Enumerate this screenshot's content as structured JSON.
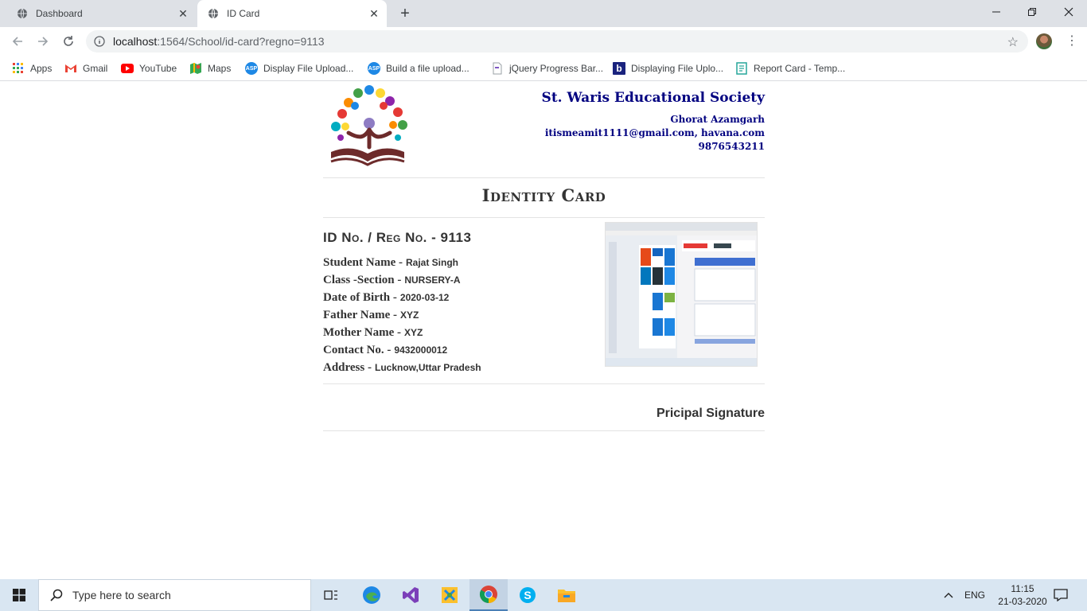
{
  "browser": {
    "tabs": [
      {
        "label": "Dashboard",
        "active": false
      },
      {
        "label": "ID Card",
        "active": true
      }
    ],
    "url_host": "localhost",
    "url_path": ":1564/School/id-card?regno=9113",
    "bookmarks": [
      {
        "label": "Apps",
        "icon": "apps-grid-icon"
      },
      {
        "label": "Gmail",
        "icon": "gmail-icon"
      },
      {
        "label": "YouTube",
        "icon": "youtube-icon"
      },
      {
        "label": "Maps",
        "icon": "maps-icon"
      },
      {
        "label": "Display File Upload...",
        "icon": "asp-icon"
      },
      {
        "label": "Build a file upload...",
        "icon": "asp-icon"
      },
      {
        "label": "jQuery Progress Bar...",
        "icon": "page-icon"
      },
      {
        "label": "Displaying File Uplo...",
        "icon": "b-icon"
      },
      {
        "label": "Report Card - Temp...",
        "icon": "template-icon"
      }
    ]
  },
  "card": {
    "org_name": "St. Waris Educational Society",
    "address_line": "Ghorat Azamgarh",
    "contact_line": "itismeamit1111@gmail.com,  havana.com",
    "phone_line": "9876543211",
    "title": "Identity Card",
    "reg_label": "ID No. / Reg No. -",
    "reg_value": "9113",
    "fields": [
      {
        "label": "Student Name -",
        "value": "Rajat Singh"
      },
      {
        "label": "Class -Section -",
        "value": "NURSERY-A"
      },
      {
        "label": "Date of Birth -",
        "value": "2020-03-12"
      },
      {
        "label": "Father Name -",
        "value": "XYZ"
      },
      {
        "label": "Mother Name -",
        "value": "XYZ"
      },
      {
        "label": "Contact No. -",
        "value": "9432000012"
      },
      {
        "label": "Address -",
        "value": "Lucknow,Uttar Pradesh"
      }
    ],
    "signature_label": "Pricipal Signature"
  },
  "taskbar": {
    "search_placeholder": "Type here to search",
    "language": "ENG",
    "time": "11:15",
    "date": "21-03-2020"
  },
  "colors": {
    "org_text": "#000080",
    "tab_strip": "#dee1e6",
    "taskbar": "#d9e6f2"
  }
}
